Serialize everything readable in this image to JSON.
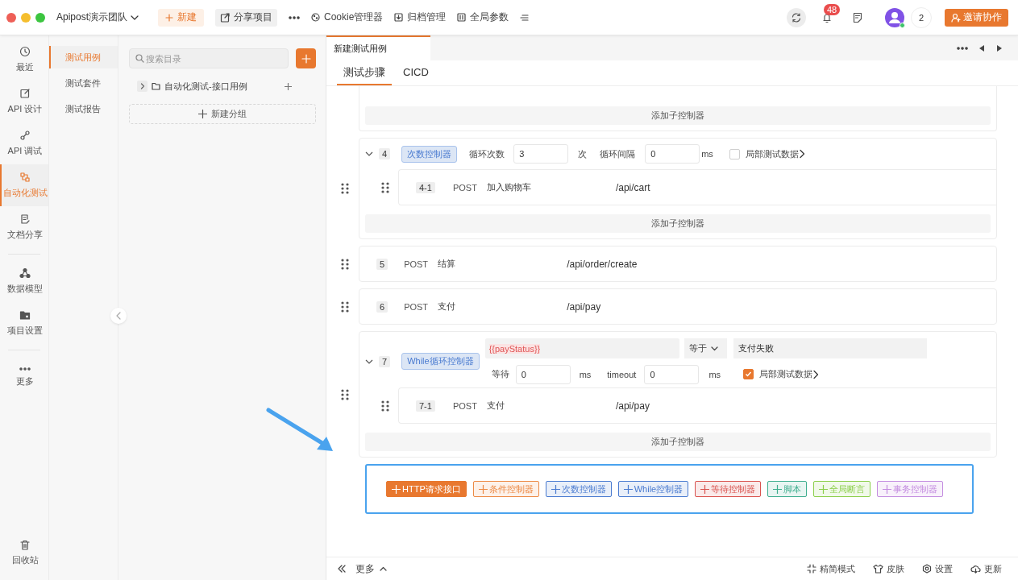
{
  "topbar": {
    "team": "Apipost演示团队",
    "actions": [
      {
        "kind": "new",
        "label": "新建"
      },
      {
        "kind": "share",
        "label": "分享项目"
      },
      {
        "kind": "more"
      },
      {
        "kind": "cookie",
        "label": "Cookie管理器"
      },
      {
        "kind": "archive",
        "label": "归档管理"
      },
      {
        "kind": "params",
        "label": "全局参数"
      },
      {
        "kind": "menu"
      }
    ],
    "notifications": "48",
    "online_count": "2",
    "invite": "邀请协作"
  },
  "nav": {
    "groups": [
      [
        {
          "kind": "recent",
          "label": "最近",
          "selected": false
        },
        {
          "kind": "design",
          "label": "API 设计",
          "selected": false
        },
        {
          "kind": "debug",
          "label": "API 调试",
          "selected": false
        },
        {
          "kind": "auto",
          "label": "自动化测试",
          "selected": true
        },
        {
          "kind": "docs",
          "label": "文档分享",
          "selected": false
        }
      ],
      [
        {
          "kind": "model",
          "label": "数据模型",
          "selected": false
        },
        {
          "kind": "settings",
          "label": "项目设置",
          "selected": false
        }
      ],
      [
        {
          "kind": "more",
          "label": "更多",
          "selected": false
        }
      ]
    ],
    "trash": "回收站"
  },
  "submenu": [
    {
      "label": "测试用例",
      "selected": true
    },
    {
      "label": "测试套件",
      "selected": false
    },
    {
      "label": "测试报告",
      "selected": false
    }
  ],
  "tree": {
    "search": {
      "placeholder": "搜索目录"
    },
    "items": [
      {
        "label": "自动化测试-接口用例",
        "expanded": false
      }
    ],
    "new_group": "新建分组"
  },
  "editor": {
    "tabs": [
      {
        "label": "新建测试用例",
        "selected": true
      }
    ],
    "subtabs": [
      {
        "label": "测试步骤",
        "selected": true
      },
      {
        "label": "CICD",
        "selected": false
      }
    ],
    "steps": [
      {
        "kind": "tail",
        "add_child": "添加子控制器"
      },
      {
        "kind": "loop",
        "number": "4",
        "expanded": true,
        "tag": "次数控制器",
        "count_label": "循环次数",
        "count": "3",
        "count_unit": "次",
        "interval_label": "循环间隔",
        "interval": "0",
        "interval_unit": "ms",
        "local_data": {
          "label": "局部测试数据",
          "checked": false
        },
        "children": [
          {
            "number": "4-1",
            "method": "POST",
            "name": "加入购物车",
            "path": "/api/cart"
          }
        ],
        "add_child": "添加子控制器"
      },
      {
        "kind": "request",
        "number": "5",
        "method": "POST",
        "name": "结算",
        "path": "/api/order/create"
      },
      {
        "kind": "request",
        "number": "6",
        "method": "POST",
        "name": "支付",
        "path": "/api/pay"
      },
      {
        "kind": "while",
        "number": "7",
        "expanded": true,
        "tag": "While循环控制器",
        "variable": "{{payStatus}}",
        "operator": "等于",
        "value": "支付失败",
        "wait_label": "等待",
        "wait": "0",
        "wait_unit": "ms",
        "timeout_label": "timeout",
        "timeout": "0",
        "timeout_unit": "ms",
        "local_data": {
          "label": "局部测试数据",
          "checked": true
        },
        "children": [
          {
            "number": "7-1",
            "method": "POST",
            "name": "支付",
            "path": "/api/pay"
          }
        ],
        "add_child": "添加子控制器"
      }
    ],
    "add_buttons": [
      {
        "label": "HTTP请求接口",
        "color": "#e8782f",
        "solid": true
      },
      {
        "label": "条件控制器",
        "color": "#ec8a45",
        "solid": false
      },
      {
        "label": "次数控制器",
        "color": "#4a7bd0",
        "solid": false
      },
      {
        "label": "While控制器",
        "color": "#4a7bd0",
        "solid": false
      },
      {
        "label": "等待控制器",
        "color": "#d9534f",
        "solid": false
      },
      {
        "label": "脚本",
        "color": "#3fae8f",
        "solid": false
      },
      {
        "label": "全局断言",
        "color": "#8bcf4a",
        "solid": false
      },
      {
        "label": "事务控制器",
        "color": "#c48de0",
        "solid": false
      }
    ]
  },
  "status_bar": {
    "more": "更多",
    "items": [
      {
        "kind": "compact",
        "label": "精简模式"
      },
      {
        "kind": "skin",
        "label": "皮肤"
      },
      {
        "kind": "settings",
        "label": "设置"
      },
      {
        "kind": "update",
        "label": "更新"
      }
    ]
  }
}
